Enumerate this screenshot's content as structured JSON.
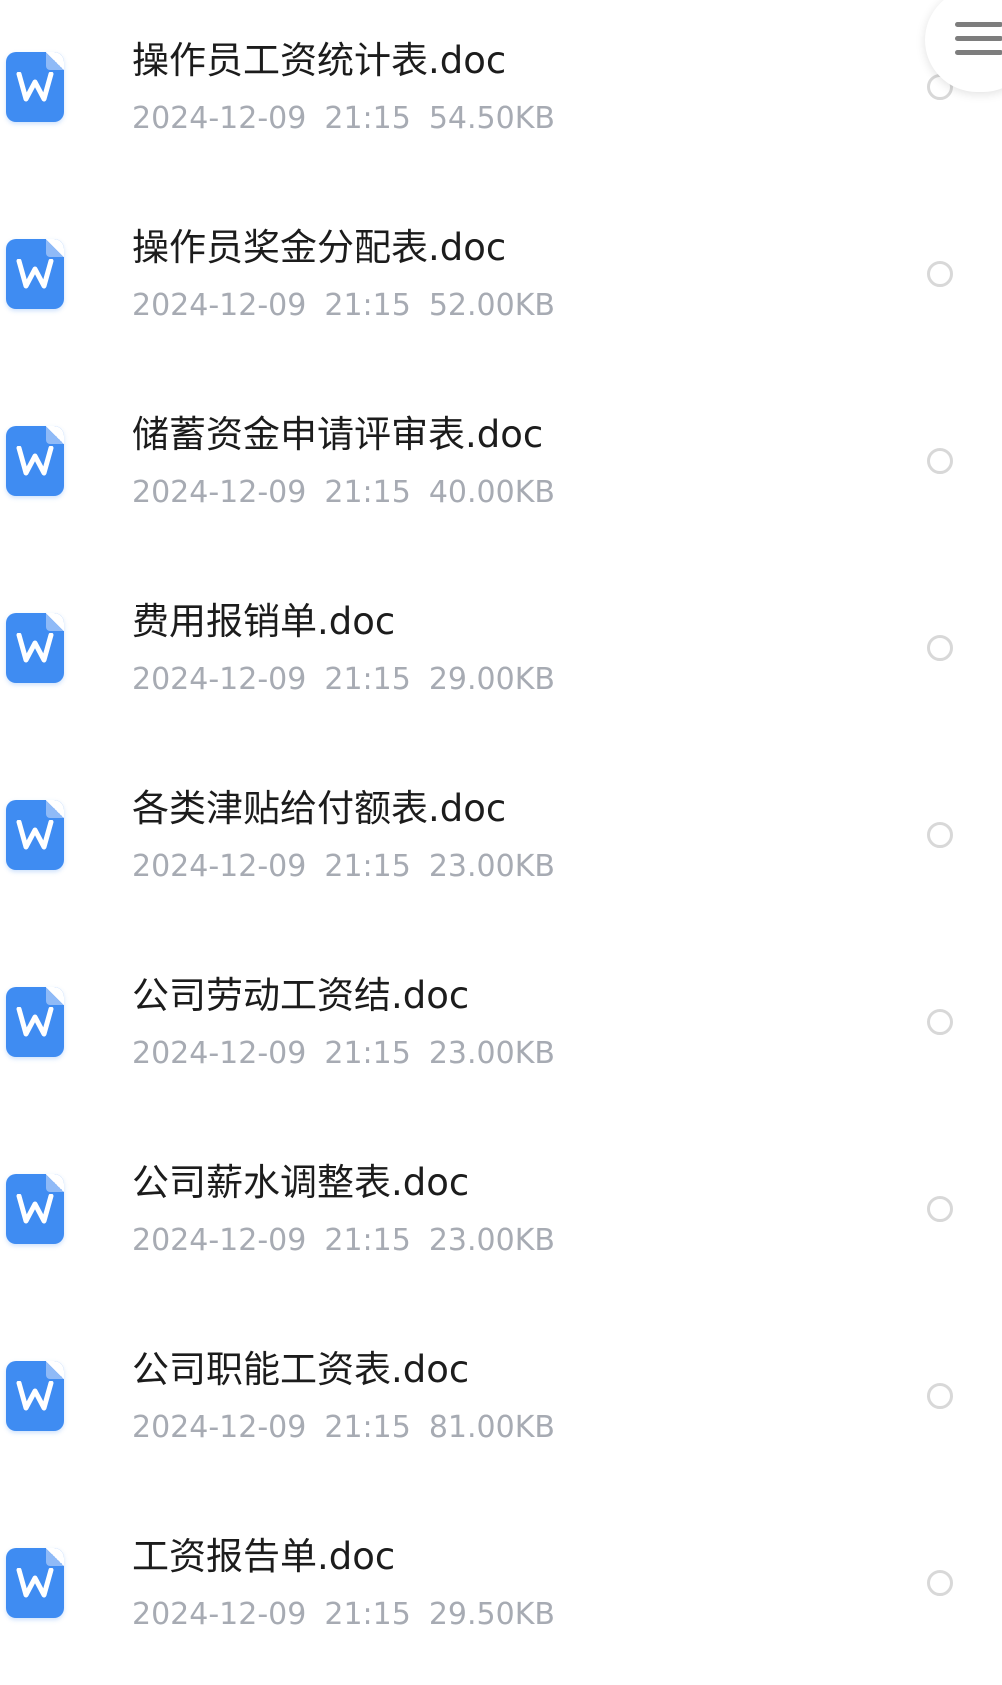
{
  "files": [
    {
      "name": "操作员工资统计表.doc",
      "date": "2024-12-09",
      "time": "21:15",
      "size": "54.50KB",
      "icon": "word-doc-icon"
    },
    {
      "name": "操作员奖金分配表.doc",
      "date": "2024-12-09",
      "time": "21:15",
      "size": "52.00KB",
      "icon": "word-doc-icon"
    },
    {
      "name": "储蓄资金申请评审表.doc",
      "date": "2024-12-09",
      "time": "21:15",
      "size": "40.00KB",
      "icon": "word-doc-icon"
    },
    {
      "name": "费用报销单.doc",
      "date": "2024-12-09",
      "time": "21:15",
      "size": "29.00KB",
      "icon": "word-doc-icon"
    },
    {
      "name": "各类津贴给付额表.doc",
      "date": "2024-12-09",
      "time": "21:15",
      "size": "23.00KB",
      "icon": "word-doc-icon"
    },
    {
      "name": "公司劳动工资结.doc",
      "date": "2024-12-09",
      "time": "21:15",
      "size": "23.00KB",
      "icon": "word-doc-icon"
    },
    {
      "name": "公司薪水调整表.doc",
      "date": "2024-12-09",
      "time": "21:15",
      "size": "23.00KB",
      "icon": "word-doc-icon"
    },
    {
      "name": "公司职能工资表.doc",
      "date": "2024-12-09",
      "time": "21:15",
      "size": "81.00KB",
      "icon": "word-doc-icon"
    },
    {
      "name": "工资报告单.doc",
      "date": "2024-12-09",
      "time": "21:15",
      "size": "29.50KB",
      "icon": "word-doc-icon"
    }
  ],
  "menu_button": {
    "icon": "menu-icon"
  },
  "colors": {
    "accent": "#3f8cf2",
    "title_text": "#1c1c1c",
    "meta_text": "#a7abb3",
    "radio_border": "#d8d8d8"
  }
}
